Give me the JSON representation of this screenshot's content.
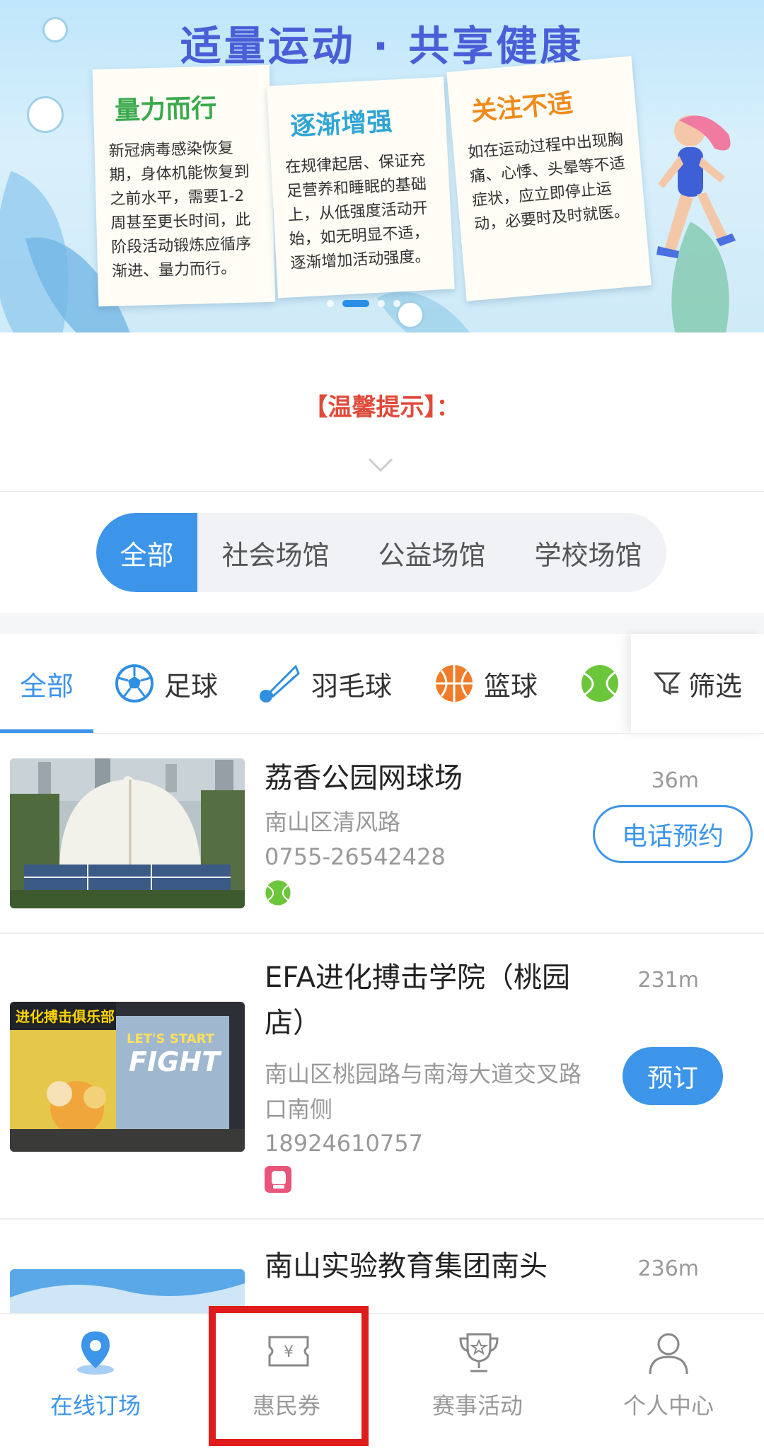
{
  "banner": {
    "title": "适量运动 · 共享健康",
    "cards": [
      {
        "heading": "量力而行",
        "body": "新冠病毒感染恢复期，身体机能恢复到之前水平，需要1-2周甚至更长时间，此阶段活动锻炼应循序渐进、量力而行。"
      },
      {
        "heading": "逐渐增强",
        "body": "在规律起居、保证充足营养和睡眠的基础上，从低强度活动开始，如无明显不适，逐渐增加活动强度。"
      },
      {
        "heading": "关注不适",
        "body": "如在运动过程中出现胸痛、心悸、头晕等不适症状，应立即停止运动，必要时及时就医。"
      }
    ]
  },
  "tip": {
    "title": "【温馨提示】："
  },
  "venue_types": {
    "options": [
      "全部",
      "社会场馆",
      "公益场馆",
      "学校场馆"
    ],
    "selected": "全部"
  },
  "sport_tabs": {
    "all": "全部",
    "items": [
      {
        "label": "足球",
        "icon": "soccer-ball-icon"
      },
      {
        "label": "羽毛球",
        "icon": "shuttlecock-icon"
      },
      {
        "label": "篮球",
        "icon": "basketball-icon"
      },
      {
        "label": "",
        "icon": "tennis-ball-icon"
      }
    ],
    "filter": "筛选"
  },
  "venues": [
    {
      "name": "荔香公园网球场",
      "address": "南山区清风路",
      "phone": "0755-26542428",
      "distance": "36m",
      "action": "电话预约",
      "sport_icon": "tennis-ball-icon"
    },
    {
      "name": "EFA进化搏击学院（桃园店）",
      "address": "南山区桃园路与南海大道交叉路口南侧",
      "phone": "18924610757",
      "distance": "231m",
      "action": "预订",
      "sport_icon": "boxing-icon",
      "photo_text": {
        "sign": "进化搏击俱乐部",
        "poster_top": "LET'S START",
        "poster_main": "FIGHT"
      }
    },
    {
      "name": "南山实验教育集团南头",
      "distance": "236m"
    }
  ],
  "bottom_nav": {
    "items": [
      {
        "label": "在线订场",
        "icon": "map-pin-icon",
        "active": true
      },
      {
        "label": "惠民券",
        "icon": "coupon-icon",
        "active": false
      },
      {
        "label": "赛事活动",
        "icon": "trophy-icon",
        "active": false
      },
      {
        "label": "个人中心",
        "icon": "user-icon",
        "active": false
      }
    ]
  },
  "colors": {
    "accent": "#3d95ea",
    "highlight": "#e01b1b",
    "tip": "#e04a3a"
  }
}
